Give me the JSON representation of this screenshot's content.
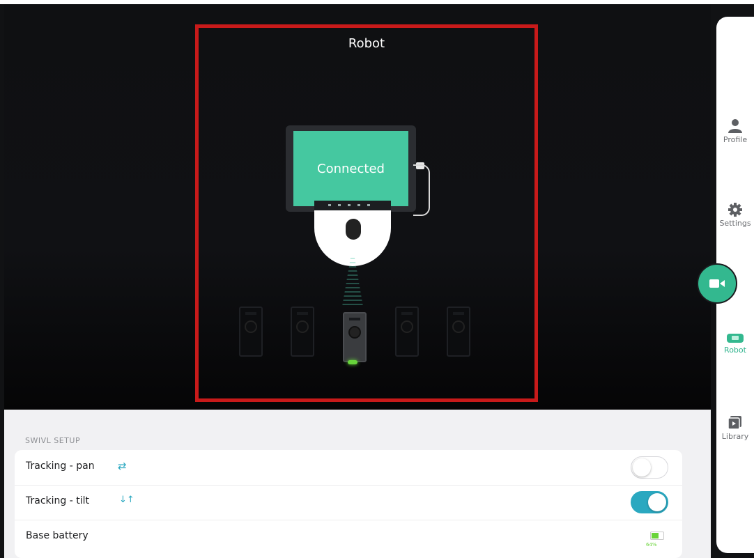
{
  "stage": {
    "title": "Robot",
    "device_status": "Connected"
  },
  "rail": {
    "items": [
      {
        "label": "Profile",
        "icon": "person-icon"
      },
      {
        "label": "Settings",
        "icon": "gear-icon"
      },
      {
        "label": "Robot",
        "icon": "robot-icon",
        "active": true
      },
      {
        "label": "Library",
        "icon": "library-icon"
      }
    ],
    "fab_icon": "video-camera-icon"
  },
  "setup": {
    "section_label": "SWIVL SETUP",
    "rows": [
      {
        "label": "Tracking - pan",
        "icon": "⇄",
        "enabled": false
      },
      {
        "label": "Tracking - tilt",
        "icon": "↓↑",
        "enabled": true
      },
      {
        "label": "Base battery",
        "battery_percent": "64%",
        "battery_level": 0.64
      }
    ]
  },
  "colors": {
    "accent": "#33b88f",
    "toggle_on": "#2aa8c0",
    "highlight_frame": "#c81a1a",
    "screen": "#45c8a0"
  }
}
